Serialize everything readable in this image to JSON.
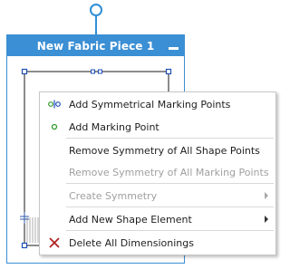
{
  "piece": {
    "title": "New Fabric Piece 1"
  },
  "menu": {
    "items": [
      {
        "label": "Add Symmetrical Marking Points",
        "icon": "symmetric-points-icon",
        "enabled": true
      },
      {
        "label": "Add Marking Point",
        "icon": "marking-point-icon",
        "enabled": true
      },
      {
        "label": "Remove Symmetry of All Shape Points",
        "enabled": true
      },
      {
        "label": "Remove Symmetry of All Marking Points",
        "enabled": false
      },
      {
        "label": "Create Symmetry",
        "enabled": false,
        "submenu": true
      },
      {
        "label": "Add New Shape Element",
        "enabled": true,
        "submenu": true
      },
      {
        "label": "Delete All Dimensionings",
        "icon": "delete-x-icon",
        "enabled": true
      }
    ]
  },
  "colors": {
    "accent": "#3b8fd4",
    "marker_green": "#2e9a2e",
    "delete_red": "#b02020",
    "disabled_text": "#a0a0a0"
  }
}
